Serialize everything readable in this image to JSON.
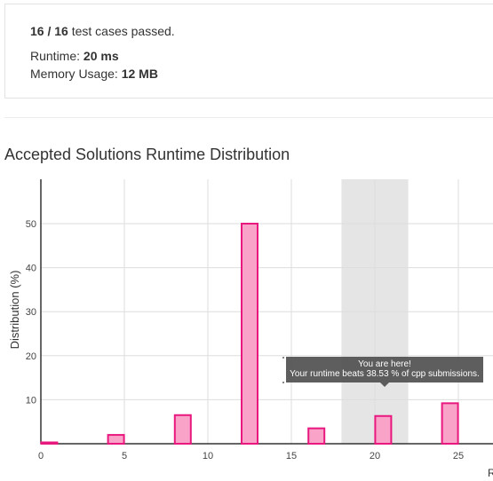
{
  "summary": {
    "passed_count": "16 / 16",
    "passed_text": " test cases passed.",
    "runtime_label": "Runtime: ",
    "runtime_value": "20 ms",
    "memory_label": "Memory Usage: ",
    "memory_value": "12 MB"
  },
  "section_title": "Accepted Solutions Runtime Distribution",
  "tooltip": {
    "line1": "You are here!",
    "line2": "Your runtime beats 38.53 % of cpp submissions."
  },
  "colors": {
    "bar_fill": "#f9a3c9",
    "bar_stroke": "#e8187e",
    "highlight_band": "#e5e5e5",
    "grid": "#dddddd",
    "axis": "#333333"
  },
  "chart_data": {
    "type": "bar",
    "ylabel": "Distribution (%)",
    "xlabel": "R",
    "x_ticks": [
      0,
      5,
      10,
      15,
      20,
      25
    ],
    "y_ticks": [
      10,
      20,
      30,
      40,
      50
    ],
    "xlim": [
      0,
      27
    ],
    "ylim": [
      0,
      60
    ],
    "grid": true,
    "highlight_range": [
      18,
      22
    ],
    "bars": [
      {
        "x": 0.5,
        "value": 0.3
      },
      {
        "x": 4.5,
        "value": 2.0
      },
      {
        "x": 8.5,
        "value": 6.5
      },
      {
        "x": 12.5,
        "value": 50.0
      },
      {
        "x": 16.5,
        "value": 3.5
      },
      {
        "x": 20.5,
        "value": 6.3
      },
      {
        "x": 24.5,
        "value": 9.2
      }
    ]
  }
}
